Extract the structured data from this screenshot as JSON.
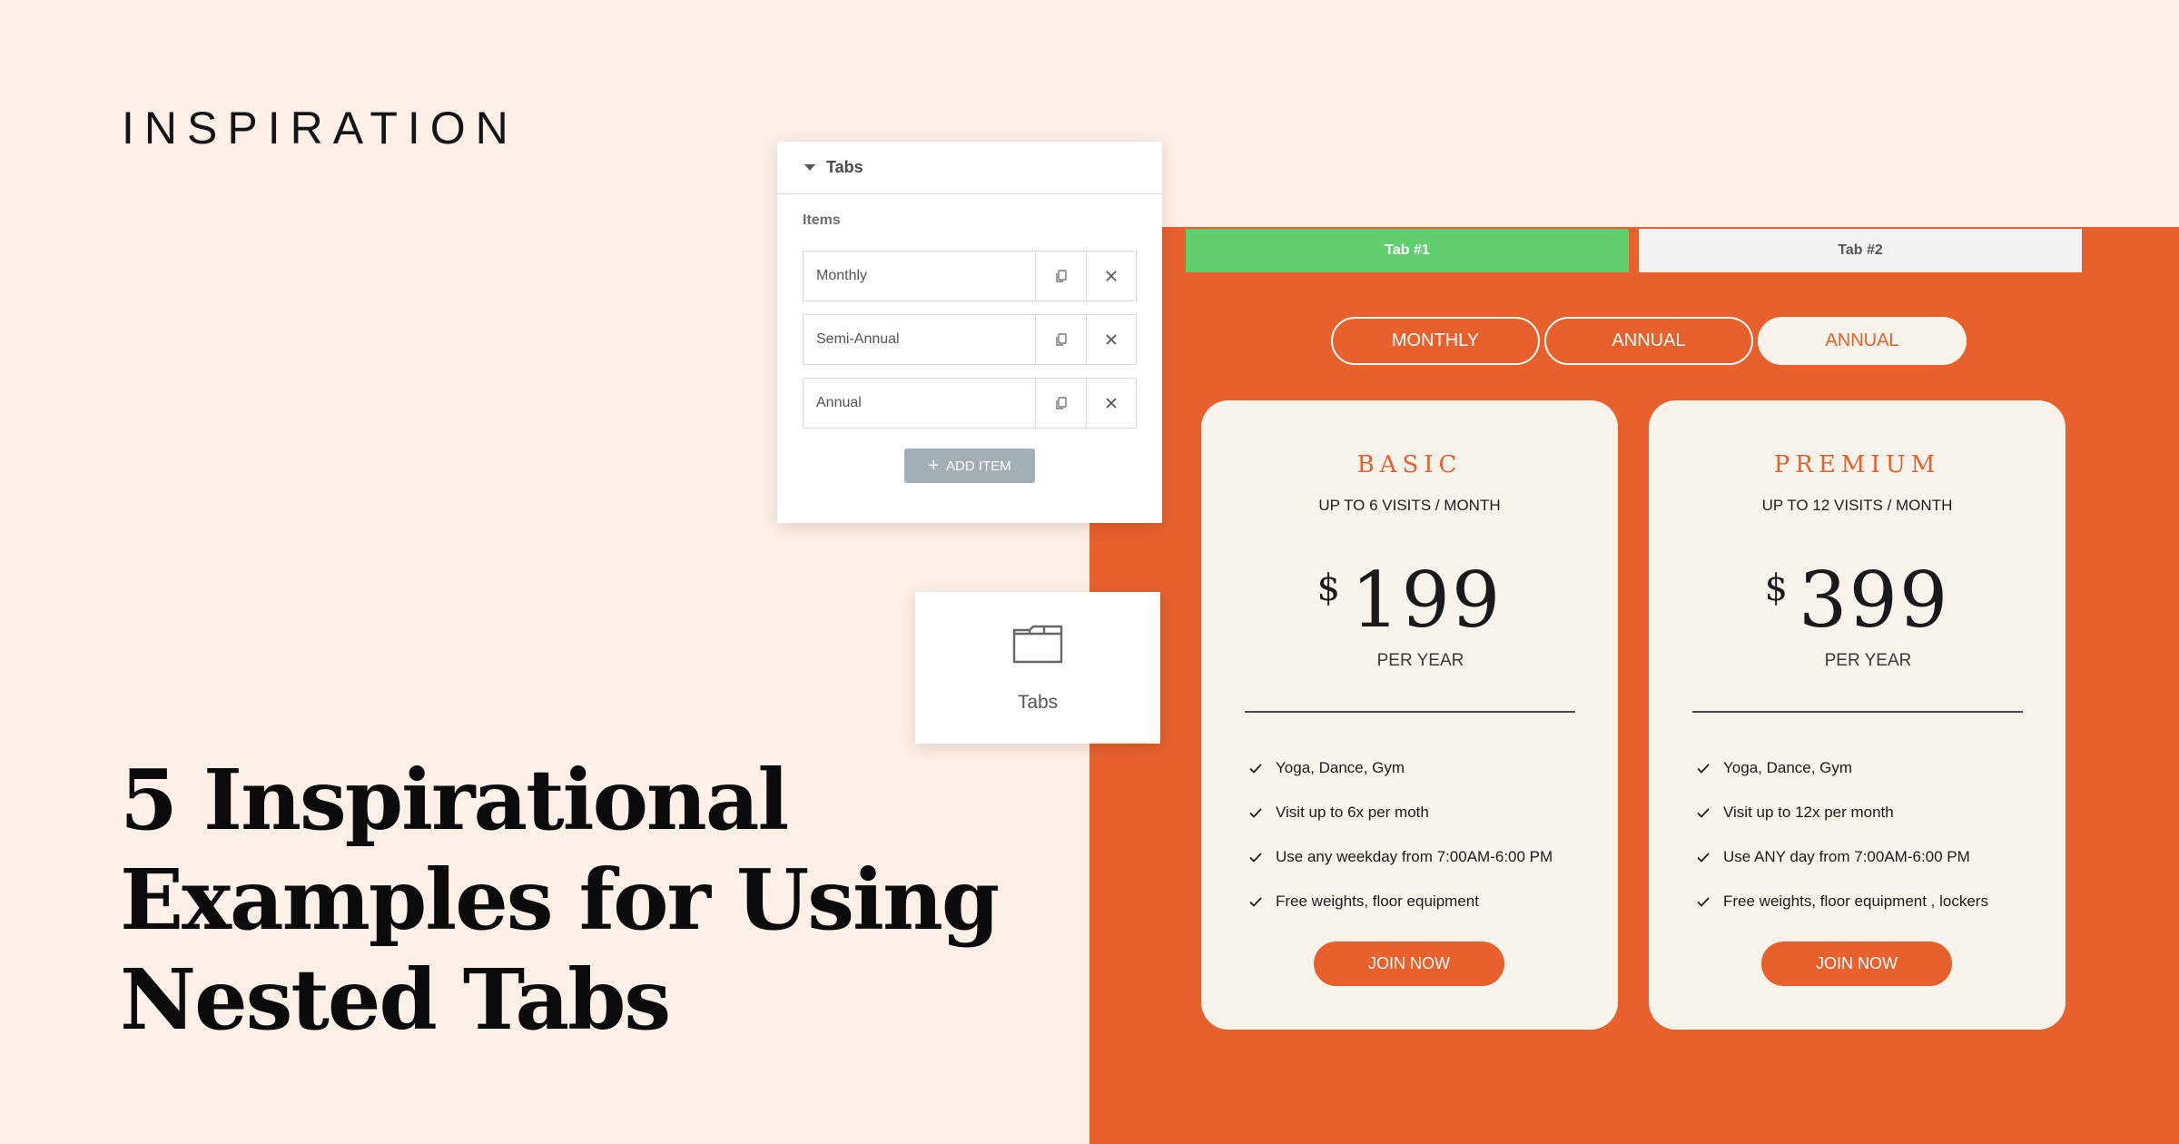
{
  "eyebrow": "INSPIRATION",
  "headline": "5 Inspirational Examples for Using Nested Tabs",
  "editor": {
    "section_title": "Tabs",
    "items_label": "Items",
    "items": [
      "Monthly",
      "Semi-Annual",
      "Annual"
    ],
    "add_item_label": "ADD ITEM"
  },
  "widget": {
    "label": "Tabs",
    "icon": "folder-icon"
  },
  "nested_tabs": [
    "Tab #1",
    "Tab #2"
  ],
  "billing_options": [
    "MONTHLY",
    "ANNUAL",
    "ANNUAL"
  ],
  "cards": [
    {
      "tier": "BASIC",
      "visits": "UP TO 6 VISITS / MONTH",
      "currency": "$",
      "price": "199",
      "period": "PER YEAR",
      "features": [
        "Yoga, Dance, Gym",
        "Visit up to 6x per moth",
        "Use any weekday from 7:00AM-6:00 PM",
        "Free weights, floor equipment"
      ],
      "cta": "JOIN NOW"
    },
    {
      "tier": "PREMIUM",
      "visits": "UP TO 12 VISITS / MONTH",
      "currency": "$",
      "price": "399",
      "period": "PER YEAR",
      "features": [
        "Yoga, Dance, Gym",
        "Visit up to 12x per month",
        "Use ANY day from 7:00AM-6:00 PM",
        "Free weights, floor equipment , lockers"
      ],
      "cta": "JOIN NOW"
    }
  ],
  "colors": {
    "background": "#fdf0e8",
    "orange": "#e8612d",
    "active_tab": "#62cf6e",
    "card": "#f8f4ec"
  }
}
